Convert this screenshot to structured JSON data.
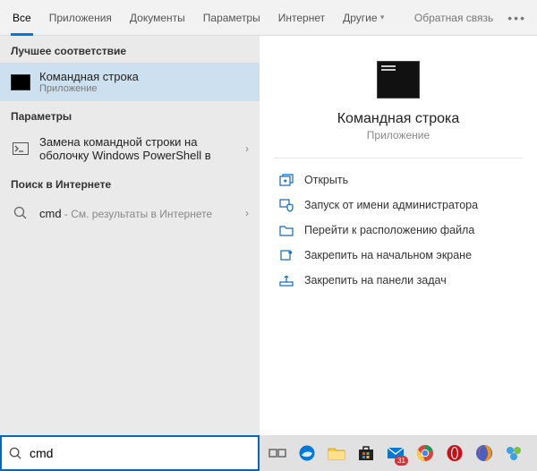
{
  "tabs": {
    "all": "Все",
    "apps": "Приложения",
    "documents": "Документы",
    "settings": "Параметры",
    "internet": "Интернет",
    "other": "Другие",
    "feedback": "Обратная связь"
  },
  "sections": {
    "best_match": "Лучшее соответствие",
    "settings": "Параметры",
    "web": "Поиск в Интернете"
  },
  "results": {
    "cmd": {
      "title": "Командная строка",
      "sub": "Приложение"
    },
    "setting": {
      "title_line1": "Замена командной строки на",
      "title_line2": "оболочку Windows PowerShell в"
    },
    "web": {
      "query": "cmd",
      "hint": " - См. результаты в Интернете"
    }
  },
  "preview": {
    "title": "Командная строка",
    "sub": "Приложение"
  },
  "actions": {
    "open": "Открыть",
    "run_admin": "Запуск от имени администратора",
    "open_location": "Перейти к расположению файла",
    "pin_start": "Закрепить на начальном экране",
    "pin_taskbar": "Закрепить на панели задач"
  },
  "search": {
    "value": "cmd"
  }
}
